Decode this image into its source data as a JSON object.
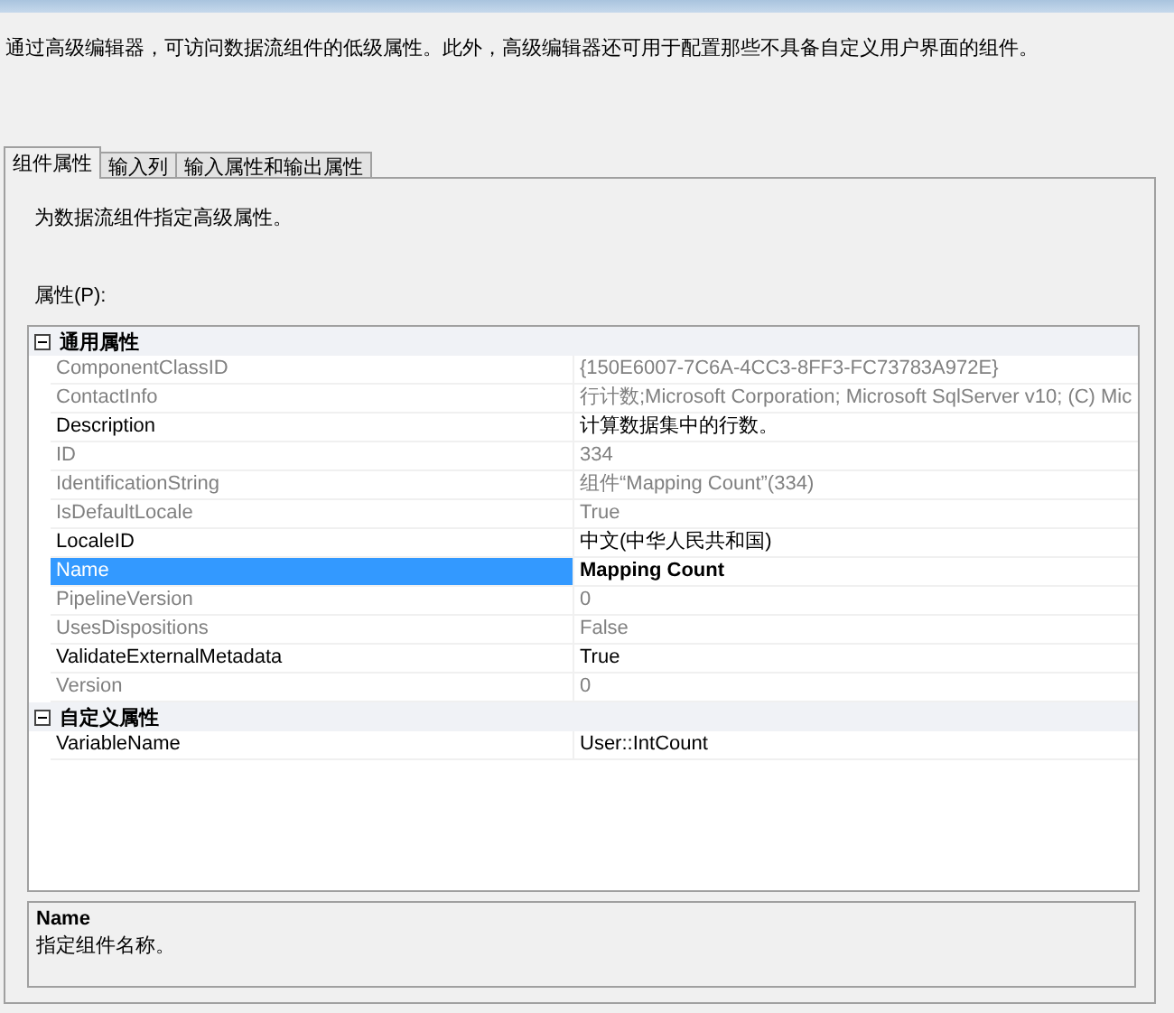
{
  "intro": "通过高级编辑器，可访问数据流组件的低级属性。此外，高级编辑器还可用于配置那些不具备自定义用户界面的组件。",
  "tabs": [
    {
      "label": "组件属性",
      "selected": true
    },
    {
      "label": "输入列",
      "selected": false
    },
    {
      "label": "输入属性和输出属性",
      "selected": false
    }
  ],
  "panel_caption": "为数据流组件指定高级属性。",
  "properties_label": "属性(P):",
  "grid": [
    {
      "category": "通用属性",
      "expanded": true,
      "rows": [
        {
          "name": "ComponentClassID",
          "value": "{150E6007-7C6A-4CC3-8FF3-FC73783A972E}",
          "readonly": true,
          "selected": false,
          "bold": false
        },
        {
          "name": "ContactInfo",
          "value": "行计数;Microsoft Corporation; Microsoft SqlServer v10; (C) Mic",
          "readonly": true,
          "selected": false,
          "bold": false
        },
        {
          "name": "Description",
          "value": "计算数据集中的行数。",
          "readonly": false,
          "selected": false,
          "bold": false
        },
        {
          "name": "ID",
          "value": "334",
          "readonly": true,
          "selected": false,
          "bold": false
        },
        {
          "name": "IdentificationString",
          "value": "组件“Mapping Count”(334)",
          "readonly": true,
          "selected": false,
          "bold": false
        },
        {
          "name": "IsDefaultLocale",
          "value": "True",
          "readonly": true,
          "selected": false,
          "bold": false
        },
        {
          "name": "LocaleID",
          "value": "中文(中华人民共和国)",
          "readonly": false,
          "selected": false,
          "bold": false
        },
        {
          "name": "Name",
          "value": "Mapping Count",
          "readonly": false,
          "selected": true,
          "bold": true
        },
        {
          "name": "PipelineVersion",
          "value": "0",
          "readonly": true,
          "selected": false,
          "bold": false
        },
        {
          "name": "UsesDispositions",
          "value": "False",
          "readonly": true,
          "selected": false,
          "bold": false
        },
        {
          "name": "ValidateExternalMetadata",
          "value": "True",
          "readonly": false,
          "selected": false,
          "bold": false
        },
        {
          "name": "Version",
          "value": "0",
          "readonly": true,
          "selected": false,
          "bold": false
        }
      ]
    },
    {
      "category": "自定义属性",
      "expanded": true,
      "rows": [
        {
          "name": "VariableName",
          "value": "User::IntCount",
          "readonly": false,
          "selected": false,
          "bold": false
        }
      ]
    }
  ],
  "help": {
    "title": "Name",
    "text": "指定组件名称。"
  }
}
